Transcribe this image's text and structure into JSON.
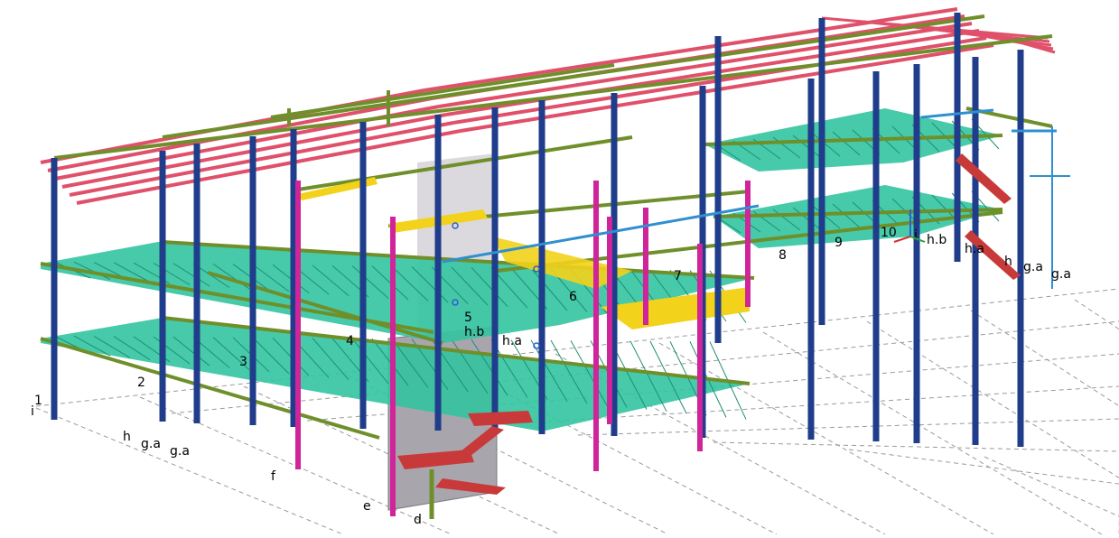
{
  "viewport": {
    "name": "3D model view"
  },
  "gridline_labels": [
    "1",
    "i",
    "h",
    "g.a",
    "g.a",
    "f",
    "e",
    "d"
  ],
  "axis_labels": [
    "2",
    "3",
    "4",
    "5",
    "h.b",
    "h.a",
    "6",
    "7",
    "8",
    "9",
    "10",
    "i",
    "h.b",
    "h.a",
    "h",
    "g.a",
    "g.a"
  ],
  "colors": {
    "background": "#ffffff",
    "grid": "#9a9a9a",
    "column": "#1f3d8a",
    "column_magenta": "#d0259a",
    "purlin_red": "#e0506a",
    "deck_teal": "#33c4a0",
    "beam_green": "#6f8f2a",
    "highlight_yellow": "#f2d21a",
    "wall_gray": "#a9a5ad",
    "stair_red": "#c83a3a"
  }
}
